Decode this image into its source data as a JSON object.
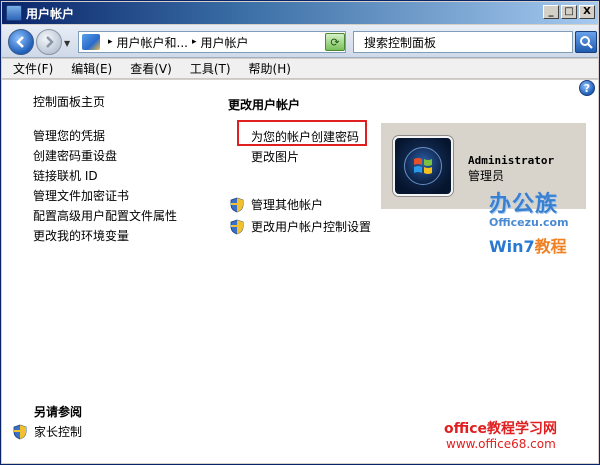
{
  "window": {
    "title": "用户帐户",
    "controls": {
      "minimize": "_",
      "maximize": "□",
      "close": "X"
    }
  },
  "address_bar": {
    "crumbs": [
      "用户帐户和...",
      "用户帐户"
    ],
    "search_placeholder": "搜索控制面板"
  },
  "menu": [
    "文件(F)",
    "编辑(E)",
    "查看(V)",
    "工具(T)",
    "帮助(H)"
  ],
  "left_pane": {
    "home": "控制面板主页",
    "links": [
      "管理您的凭据",
      "创建密码重设盘",
      "链接联机 ID",
      "管理文件加密证书",
      "配置高级用户配置文件属性",
      "更改我的环境变量"
    ],
    "see_also_title": "另请参阅",
    "see_also": [
      "家长控制"
    ]
  },
  "main": {
    "title": "更改用户帐户",
    "tasks": [
      "为您的帐户创建密码",
      "更改图片"
    ],
    "shield_tasks": [
      "管理其他帐户",
      "更改用户帐户控制设置"
    ]
  },
  "user": {
    "name": "Administrator",
    "role": "管理员"
  },
  "watermarks": {
    "brand": "办公族",
    "brand_url": "Officezu.com",
    "win7": "Win7",
    "win7_suffix": "教程",
    "office_title": "office教程学习网",
    "office_url": "www.office68.com"
  },
  "colors": {
    "highlight": "#e02020",
    "accent": "#3a80d0"
  }
}
